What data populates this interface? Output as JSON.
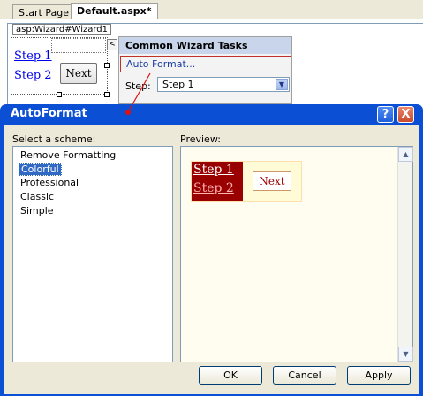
{
  "tabs": [
    {
      "label": "Start Page",
      "active": false
    },
    {
      "label": "Default.aspx*",
      "active": true
    }
  ],
  "designer": {
    "control_label": "asp:Wizard#Wizard1",
    "wizard": {
      "step1": "Step 1",
      "step2": "Step 2",
      "next": "Next"
    },
    "smart_tag_glyph": "<"
  },
  "tasks_panel": {
    "title": "Common Wizard Tasks",
    "auto_format_link": "Auto Format...",
    "step_label": "Step:",
    "step_value": "Step 1"
  },
  "dialog": {
    "title": "AutoFormat",
    "help_glyph": "?",
    "close_glyph": "X",
    "scheme_label": "Select a scheme:",
    "preview_label": "Preview:",
    "schemes": [
      "Remove Formatting",
      "Colorful",
      "Professional",
      "Classic",
      "Simple"
    ],
    "selected_scheme": "Colorful",
    "preview": {
      "step1": "Step 1",
      "step2": "Step 2",
      "next": "Next"
    },
    "buttons": {
      "ok": "OK",
      "cancel": "Cancel",
      "apply": "Apply"
    }
  },
  "colors": {
    "titlebar": "#0a4fd4",
    "selection": "#316ac5",
    "preview_sidebar": "#990000",
    "highlight_border": "#c0312b"
  }
}
